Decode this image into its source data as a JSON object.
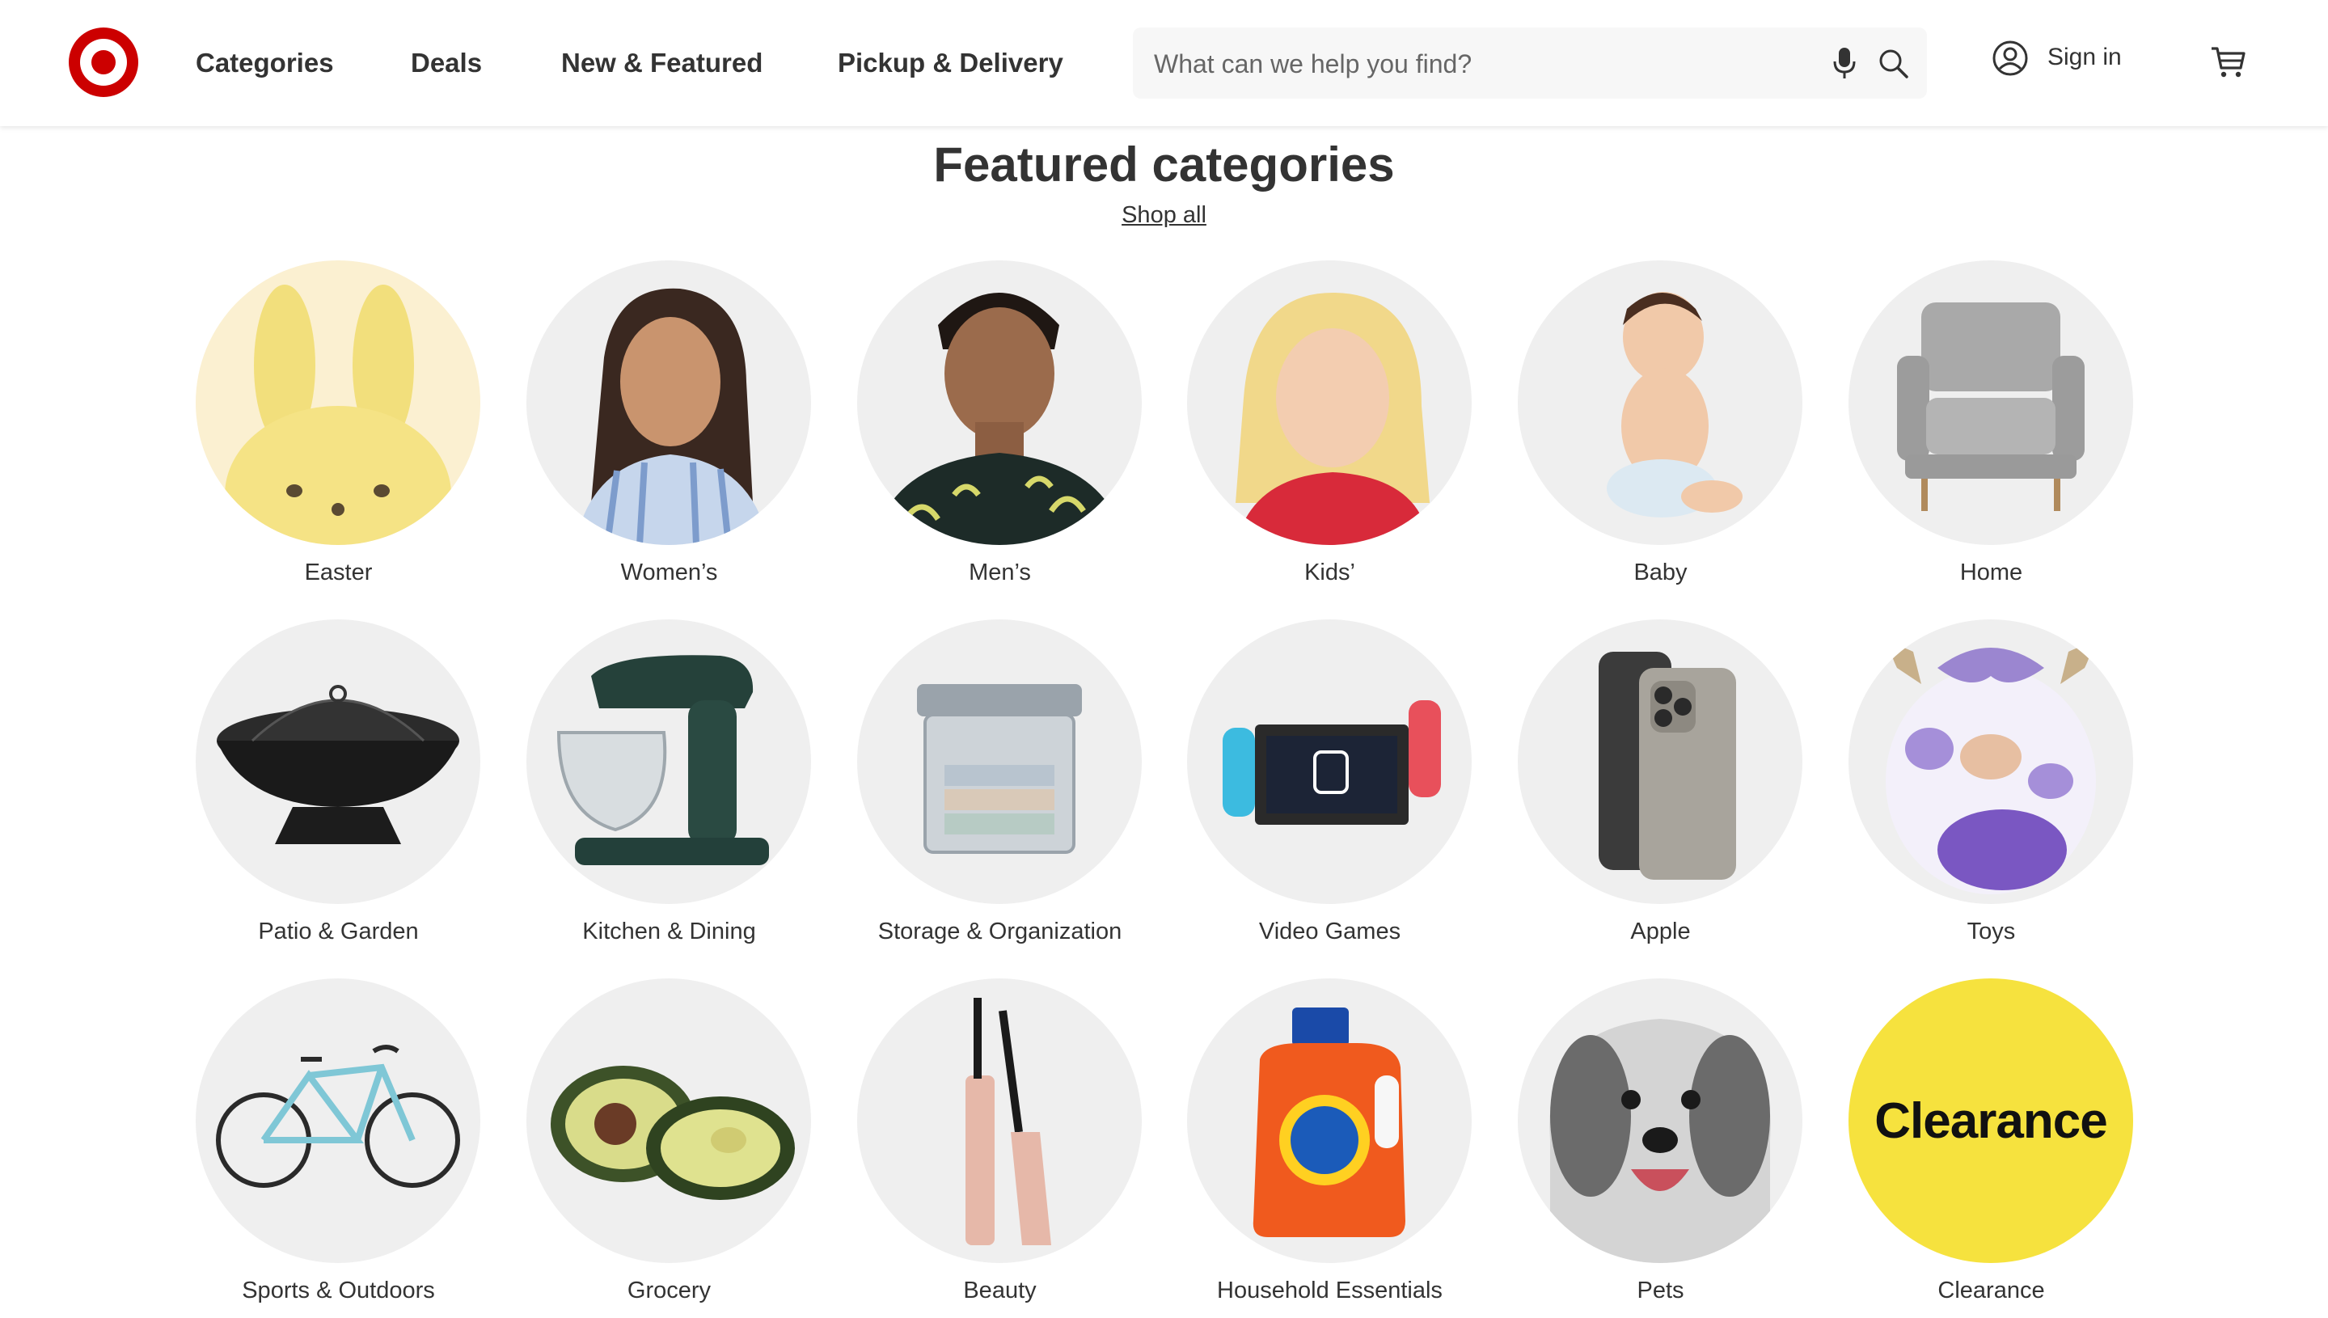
{
  "brand": {
    "name": "Target",
    "accent": "#cc0000"
  },
  "header": {
    "nav": [
      "Categories",
      "Deals",
      "New & Featured",
      "Pickup & Delivery"
    ],
    "search": {
      "placeholder": "What can we help you find?",
      "value": ""
    },
    "sign_in_label": "Sign in",
    "icons": {
      "mic": "microphone-icon",
      "search": "search-icon",
      "account": "account-icon",
      "cart": "cart-icon"
    }
  },
  "featured": {
    "title": "Featured categories",
    "shop_all_label": "Shop all",
    "categories": [
      {
        "label": "Easter",
        "image": "yellow bunny plush"
      },
      {
        "label": "Women’s",
        "image": "woman in striped shirt"
      },
      {
        "label": "Men’s",
        "image": "man in floral shirt"
      },
      {
        "label": "Kids’",
        "image": "smiling girl"
      },
      {
        "label": "Baby",
        "image": "baby in diaper"
      },
      {
        "label": "Home",
        "image": "gray armchair"
      },
      {
        "label": "Patio & Garden",
        "image": "fire pit"
      },
      {
        "label": "Kitchen & Dining",
        "image": "stand mixer"
      },
      {
        "label": "Storage & Organization",
        "image": "storage bin with towels"
      },
      {
        "label": "Video Games",
        "image": "game console"
      },
      {
        "label": "Apple",
        "image": "smartphone"
      },
      {
        "label": "Toys",
        "image": "purple cow plush"
      },
      {
        "label": "Sports & Outdoors",
        "image": "bicycle"
      },
      {
        "label": "Grocery",
        "image": "avocados"
      },
      {
        "label": "Beauty",
        "image": "mascara"
      },
      {
        "label": "Household Essentials",
        "image": "detergent bottle"
      },
      {
        "label": "Pets",
        "image": "dog"
      },
      {
        "label": "Clearance",
        "image": "yellow circle with text",
        "badge_text": "Clearance",
        "badge_color": "#f6e23e"
      }
    ]
  }
}
